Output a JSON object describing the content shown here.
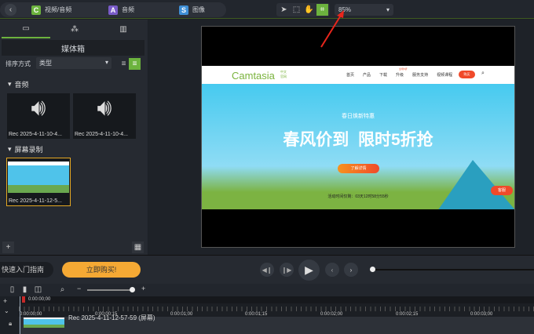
{
  "topbar": {
    "tabs": [
      {
        "label": "视频/音频",
        "icon": "C",
        "color": "#6cb33e"
      },
      {
        "label": "音频",
        "icon": "A",
        "color": "#7a5cc8"
      },
      {
        "label": "图像",
        "icon": "S",
        "color": "#3f8fd6"
      }
    ],
    "zoom": "85%"
  },
  "left_panel": {
    "title": "媒体箱",
    "sort_label": "排序方式",
    "sort_value": "类型",
    "sections": [
      {
        "name": "音频",
        "items": [
          "Rec 2025-4-11-10-4...",
          "Rec 2025-4-11-10-4..."
        ]
      },
      {
        "name": "屏幕录制",
        "items": [
          "Rec 2025-4-11-12-5..."
        ]
      }
    ]
  },
  "preview": {
    "logo": "Camtasia",
    "logo_sub": "中文官网",
    "nav": [
      "首页",
      "产品",
      "下载",
      "升级",
      "服务支持",
      "视频课程"
    ],
    "nav_badge": "全场5折",
    "buy": "购买",
    "subtitle": "春日焕新特惠",
    "headline": "春风价到  限时5折抢",
    "cta": "了解详情",
    "countdown": "活动时间仅剩：03天12时58分55秒",
    "chat": "客服"
  },
  "controls": {
    "guide": "快速入门指南",
    "buy_now": "立即购买!"
  },
  "timeline": {
    "playhead": "0:00:00;00",
    "ticks": [
      "0:00:00;00",
      "0:00:00;15",
      "0:00:01;00",
      "0:00:01;15",
      "0:00:02;00",
      "0:00:02;15",
      "0:00:03;00"
    ],
    "clip": "Rec 2025-4-11-12-57-59 (屏幕)"
  },
  "colors": {
    "accent": "#6cb33e",
    "buy": "#f5a934",
    "arrow": "#e8261c"
  }
}
